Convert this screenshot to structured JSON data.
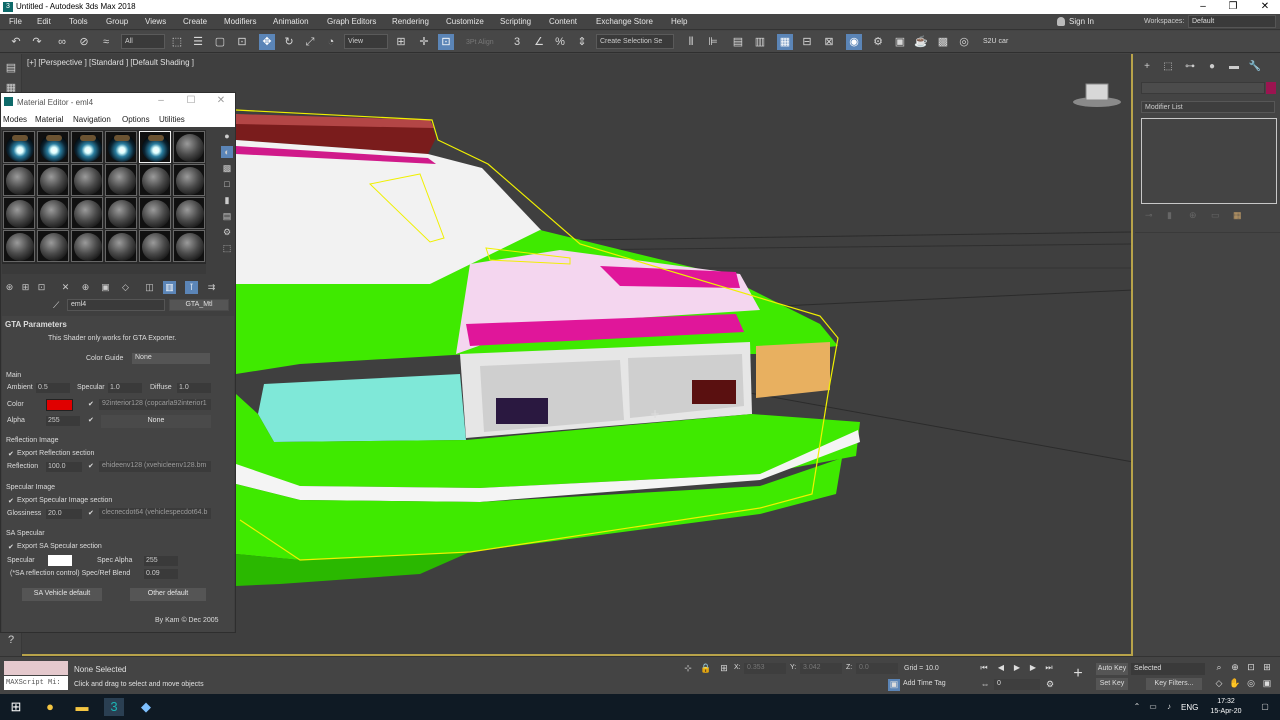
{
  "window": {
    "title": "Untitled - Autodesk 3ds Max 2018",
    "app_icon": "3",
    "minimize": "–",
    "restore": "❐",
    "close": "✕"
  },
  "menu": [
    "File",
    "Edit",
    "Tools",
    "Group",
    "Views",
    "Create",
    "Modifiers",
    "Animation",
    "Graph Editors",
    "Rendering",
    "Customize",
    "Scripting",
    "Content",
    "Exchange Store",
    "Help"
  ],
  "account": {
    "sign_in": "Sign In",
    "workspaces_label": "Workspaces:",
    "workspace": "Default"
  },
  "toolbar": {
    "filter": "All",
    "ref_coord": "View",
    "align_label": "3Pt Align",
    "selection_set": "Create Selection Se",
    "project_label": "S2U car"
  },
  "viewport": {
    "label": "[+] [Perspective ] [Standard ] [Default Shading ]",
    "body_color": "#3ff000",
    "accent_color": "#e0169a",
    "selection_color": "#f0f000"
  },
  "command_panel": {
    "modifier_list": "Modifier List",
    "object_color": "#9b1450"
  },
  "material_editor": {
    "title": "Material Editor - eml4",
    "minimize": "–",
    "restore": "☐",
    "close": "✕",
    "menu": [
      "Modes",
      "Material",
      "Navigation",
      "Options",
      "Utilities"
    ],
    "material_name": "eml4",
    "material_type": "GTA_Mtl",
    "rollout_title": "GTA Parameters",
    "note": "This Shader only works for GTA Exporter.",
    "color_guide_label": "Color Guide",
    "color_guide_value": "None",
    "main_label": "Main",
    "ambient_label": "Ambient",
    "ambient_value": "0.5",
    "specular_label": "Specular",
    "specular_value": "1.0",
    "diffuse_label": "Diffuse",
    "diffuse_value": "1.0",
    "color_label": "Color",
    "color_swatch": "#e00000",
    "color_map": "92interior128 (copcarla92interior1",
    "alpha_label": "Alpha",
    "alpha_value": "255",
    "alpha_map": "None",
    "reflection_image_label": "Reflection Image",
    "export_reflection": "Export Reflection section",
    "reflection_label": "Reflection",
    "reflection_value": "100.0",
    "reflection_map": "ehideenv128 (xvehicleenv128.bm",
    "specular_image_label": "Specular Image",
    "export_specular": "Export Specular Image section",
    "glossiness_label": "Glossiness",
    "glossiness_value": "20.0",
    "specular_map": "cleспecdot64 (vehiclespecdot64.b",
    "sa_specular_label": "SA Specular",
    "export_sa_specular": "Export SA Specular section",
    "sa_specular_swatch_label": "Specular",
    "spec_alpha_label": "Spec Alpha",
    "spec_alpha_value": "255",
    "refl_blend_label": "(*SA reflection control) Spec/Ref Blend",
    "refl_blend_value": "0.09",
    "sa_default_button": "SA Vehicle default",
    "other_default_button": "Other default",
    "credit": "By Kam © Dec 2005"
  },
  "status": {
    "maxscript": "MAXScript Mi:",
    "selection": "None Selected",
    "prompt": "Click and drag to select and move objects",
    "x_label": "X:",
    "x_value": "0.353",
    "y_label": "Y:",
    "y_value": "3.042",
    "z_label": "Z:",
    "z_value": "0.0",
    "grid": "Grid = 10.0",
    "add_time_tag": "Add Time Tag",
    "frame": "0",
    "auto_key": "Auto Key",
    "set_key": "Set Key",
    "selected": "Selected",
    "key_filters": "Key Filters..."
  },
  "taskbar": {
    "language": "ENG",
    "time": "17:32",
    "date": "15-Apr-20"
  }
}
